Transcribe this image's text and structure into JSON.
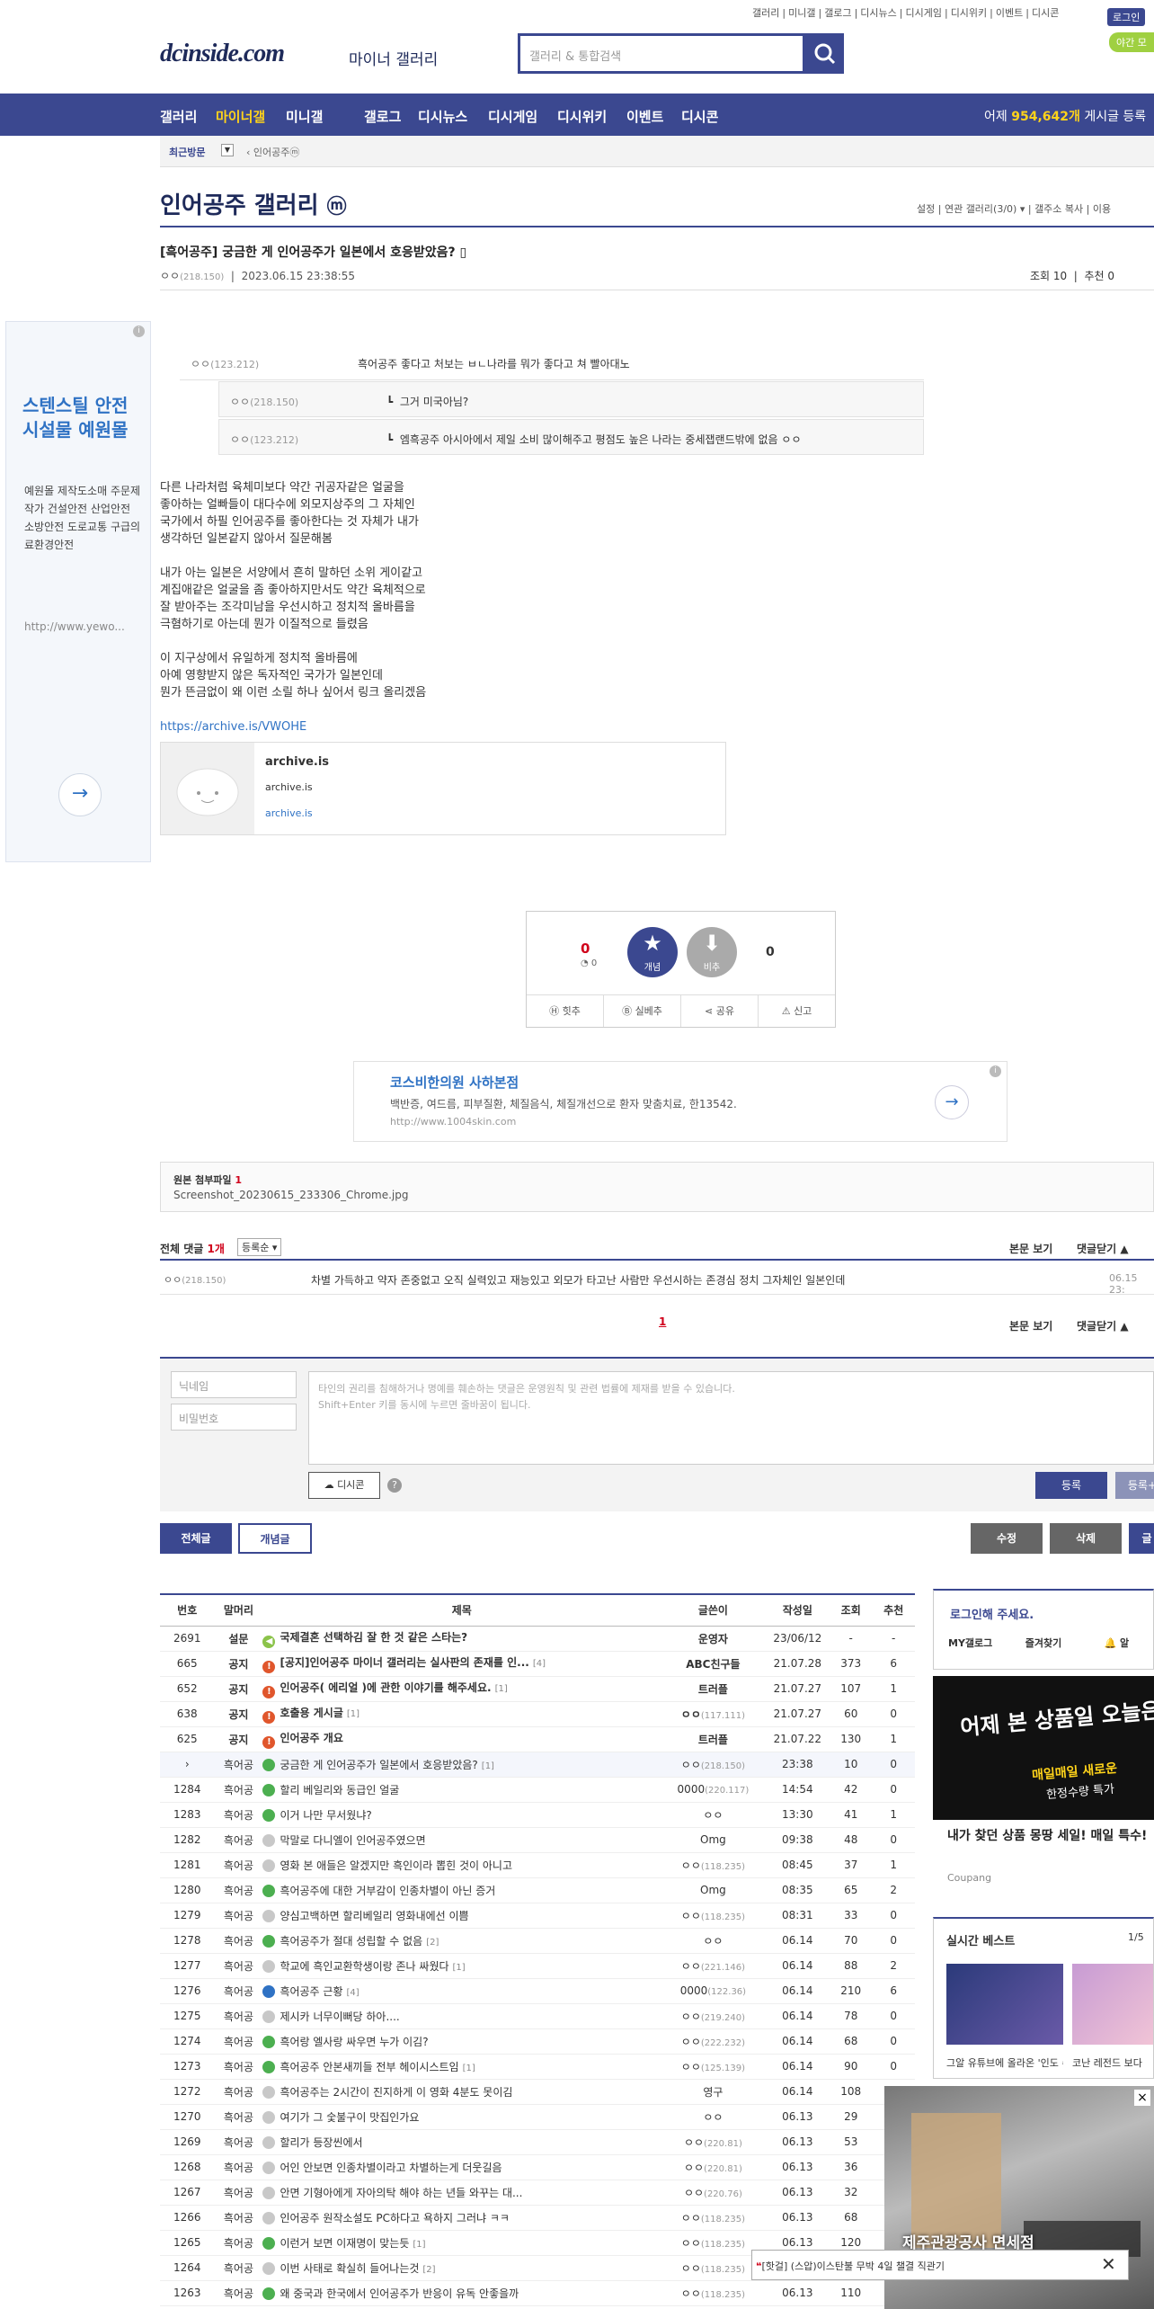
{
  "top_links": [
    "갤러리",
    "미니갤",
    "갤로그",
    "디시뉴스",
    "디시게임",
    "디시위키",
    "이벤트",
    "디시콘"
  ],
  "top_login": "로그인",
  "top_btn2": "야간 모",
  "logo": "dcinside.com",
  "logo_sub": "마이너 갤러리",
  "search": {
    "placeholder": "갤러리 & 통합검색"
  },
  "nav": {
    "items": [
      "갤러리",
      "마이너갤",
      "미니갤",
      "갤로그",
      "디시뉴스",
      "디시게임",
      "디시위키",
      "이벤트",
      "디시콘"
    ],
    "visitors_label": "어제",
    "visitors": "954,642개",
    "visitors_suffix": "게시글 등록"
  },
  "subbar": {
    "recent": "최근방문",
    "gallery": "인어공주ⓜ"
  },
  "gallery_title": "인어공주 갤러리",
  "gallery_badge": "ⓜ",
  "gallery_menu": [
    "설정",
    "연관 갤러리(3/0)",
    "갤주소 복사",
    "이용"
  ],
  "post": {
    "title": "[흑어공주] 궁금한 게 인어공주가 일본에서 호응받았음?",
    "author": "ㅇㅇ",
    "ip": "(218.150)",
    "date": "2023.06.15 23:38:55",
    "views_label": "조회 10",
    "rec_label": "추천 0"
  },
  "ad_left": {
    "title": "스텐스틸 안전시설물 예원몰",
    "desc": "예원몰 제작도소매 주문제작가 건설안전 산업안전 소방안전 도로교통 구급의료환경안전",
    "url": "http://www.yewo..."
  },
  "quoted": [
    {
      "name": "ㅇㅇ",
      "ip": "(123.212)",
      "text": "흑어공주 좋다고 처보는 ㅂㄴ나라를 뭐가 좋다고 쳐 빨아대노"
    },
    {
      "name": "ㅇㅇ",
      "ip": "(218.150)",
      "text": "그거 미국아님?"
    },
    {
      "name": "ㅇㅇ",
      "ip": "(123.212)",
      "text": "엠흑공주 아시아에서 제일 소비 많이해주고 평점도 높은 나라는 중세잽랜드밖에 없음 ㅇㅇ"
    }
  ],
  "body": [
    "다른 나라처럼 육체미보다 약간 귀공자같은 얼굴을",
    "좋아하는 얼빠들이 대다수에 외모지상주의 그 자체인",
    "국가에서 하필 인어공주를 좋아한다는 것 자체가 내가",
    "생각하던 일본같지 않아서 질문해봄",
    "",
    "내가 아는 일본은 서양에서 흔히 말하던 소위 게이같고",
    "계집애같은 얼굴을 좀 좋아하지만서도 약간 육체적으로",
    "잘 받아주는 조각미남을 우선시하고 정치적 올바름을",
    "극혐하기로 아는데 뭔가 이질적으로 들렸음",
    "",
    "이 지구상에서 유일하게 정치적 올바름에",
    "아예 영향받지 않은 독자적인 국가가 일본인데",
    "뭔가 뜬금없이 왜 이런 소릴 하나 싶어서 링크 올리겠음"
  ],
  "link_url": "https://archive.is/VWOHE",
  "card": {
    "title": "archive.is",
    "line2": "archive.is",
    "line3": "archive.is"
  },
  "vote": {
    "up": "0",
    "up_fix": "0",
    "up_label": "개념",
    "down_label": "비추",
    "down": "0",
    "actions": [
      "힛추",
      "실베추",
      "공유",
      "신고"
    ]
  },
  "ad_mid": {
    "title": "코스비한의원 사하본점",
    "desc": "백반증, 여드름, 피부질환, 체질음식, 체질개선으로 환자 맞춤치료, 한13542.",
    "url": "http://www.1004skin.com"
  },
  "attach": {
    "label": "원본 첨부파일",
    "count": "1",
    "file": "Screenshot_20230615_233306_Chrome.jpg"
  },
  "comments": {
    "label": "전체 댓글",
    "count": "1개",
    "sort": "등록순",
    "view": "본문 보기",
    "close": "댓글닫기",
    "items": [
      {
        "name": "ㅇㅇ",
        "ip": "(218.150)",
        "text": "차별 가득하고 약자 존중없고 오직 실력있고 재능있고 외모가 타고난 사람만 우선시하는 존경심 정치 그자체인 일본인데",
        "date": "06.15 23:"
      }
    ],
    "page": "1"
  },
  "write": {
    "nick": "닉네임",
    "pw": "비밀번호",
    "placeholder1": "타인의 권리를 침해하거나 명예를 훼손하는 댓글은 운영원칙 및 관련 법률에 제재를 받을 수 있습니다.",
    "placeholder2": "Shift+Enter 키를 동시에 누르면 줄바꿈이 됩니다.",
    "dccon": "디시콘",
    "submit": "등록",
    "submit2": "등록+"
  },
  "list_btns": {
    "all": "전체글",
    "concept": "개념글",
    "edit": "수정",
    "delete": "삭제",
    "write": "글"
  },
  "list": {
    "headers": [
      "번호",
      "말머리",
      "제목",
      "글쓴이",
      "작성일",
      "조회",
      "추천"
    ],
    "rows": [
      [
        "2691",
        "설문",
        "국제결혼 선택하김 잘 한 것 같은 스타는?",
        "",
        "운영자",
        "",
        "23/06/12",
        "-",
        "-",
        "s"
      ],
      [
        "665",
        "공지",
        "[공지]인어공주 마이너 갤러리는 실사판의 존재를 인...",
        "[4]",
        "ABC친구들",
        "",
        "21.07.28",
        "373",
        "6",
        "n"
      ],
      [
        "652",
        "공지",
        "인어공주( 에리얼 )에 관한 이야기를 해주세요.",
        "[1]",
        "트러플",
        "",
        "21.07.27",
        "107",
        "1",
        "n"
      ],
      [
        "638",
        "공지",
        "호출용 게시글",
        "[1]",
        "ㅇㅇ",
        "(117.111)",
        "21.07.27",
        "60",
        "0",
        "n"
      ],
      [
        "625",
        "공지",
        "인어공주 개요",
        "",
        "트러플",
        "",
        "21.07.22",
        "130",
        "1",
        "n"
      ],
      [
        "›",
        "흑어공",
        "궁금한 게 인어공주가 일본에서 호응받았음?",
        "[1]",
        "ㅇㅇ",
        "(218.150)",
        "23:38",
        "10",
        "0",
        "c"
      ],
      [
        "1284",
        "흑어공",
        "할리 베일리와 동급인 얼굴",
        "",
        "0000",
        "(220.117)",
        "14:54",
        "42",
        "0",
        "g"
      ],
      [
        "1283",
        "흑어공",
        "이거 나만 무서웠냐?",
        "",
        "ㅇㅇ",
        "",
        "13:30",
        "41",
        "1",
        "g"
      ],
      [
        "1282",
        "흑어공",
        "막말로 다니엘이 인어공주였으면",
        "",
        "Omg",
        "",
        "09:38",
        "48",
        "0",
        "t"
      ],
      [
        "1281",
        "흑어공",
        "영화 본 애들은 알겠지만 흑인이라 뽑힌 것이 아니고",
        "",
        "ㅇㅇ",
        "(118.235)",
        "08:45",
        "37",
        "1",
        "t"
      ],
      [
        "1280",
        "흑어공",
        "흑어공주에 대한 거부감이 인종차별이 아닌 증거",
        "",
        "Omg",
        "",
        "08:35",
        "65",
        "2",
        "g"
      ],
      [
        "1279",
        "흑어공",
        "양심고백하면 할리베일리 영화내에선 이쁨",
        "",
        "ㅇㅇ",
        "(118.235)",
        "08:31",
        "33",
        "0",
        "t"
      ],
      [
        "1278",
        "흑어공",
        "흑어공주가 절대 성립할 수 없음",
        "[2]",
        "ㅇㅇ",
        "",
        "06.14",
        "70",
        "0",
        "g"
      ],
      [
        "1277",
        "흑어공",
        "학교에 흑인교환학생이랑 존나 싸웠다",
        "[1]",
        "ㅇㅇ",
        "(221.146)",
        "06.14",
        "88",
        "2",
        "t"
      ],
      [
        "1276",
        "흑어공",
        "흑어공주 근황",
        "[4]",
        "0000",
        "(122.36)",
        "06.14",
        "210",
        "6",
        "b"
      ],
      [
        "1275",
        "흑어공",
        "제시카 너무이뻐당 하아....",
        "",
        "ㅇㅇ",
        "(219.240)",
        "06.14",
        "78",
        "0",
        "t"
      ],
      [
        "1274",
        "흑어공",
        "흑어랑 엘사랑 싸우면 누가 이김?",
        "",
        "ㅇㅇ",
        "(222.232)",
        "06.14",
        "68",
        "0",
        "g"
      ],
      [
        "1273",
        "흑어공",
        "흑어공주 안본새끼들 전부 헤이시스트임",
        "[1]",
        "ㅇㅇ",
        "(125.139)",
        "06.14",
        "90",
        "0",
        "g"
      ],
      [
        "1272",
        "흑어공",
        "흑어공주는 2시간이 진지하게 이 영화 4분도 못이김",
        "",
        "영구",
        "",
        "06.14",
        "108",
        "0",
        "t"
      ],
      [
        "1270",
        "흑어공",
        "여기가 그 숯불구이 맛집인가요",
        "",
        "ㅇㅇ",
        "",
        "06.13",
        "29",
        "0",
        "t"
      ],
      [
        "1269",
        "흑어공",
        "할리가 등장씬에서",
        "",
        "ㅇㅇ",
        "(220.81)",
        "06.13",
        "53",
        "0",
        "t"
      ],
      [
        "1268",
        "흑어공",
        "어인 안보면 인종차별이라고 차별하는게 더웃길음",
        "",
        "ㅇㅇ",
        "(220.81)",
        "06.13",
        "36",
        "0",
        "t"
      ],
      [
        "1267",
        "흑어공",
        "안면 기형아에게 자아의탁 해야 하는 년들 와꾸는 대...",
        "",
        "ㅇㅇ",
        "(220.76)",
        "06.13",
        "32",
        "0",
        "t"
      ],
      [
        "1266",
        "흑어공",
        "인어공주 원작소설도 PC하다고 욕하지 그러냐 ㅋㅋ",
        "",
        "ㅇㅇ",
        "(118.235)",
        "06.13",
        "68",
        "0",
        "t"
      ],
      [
        "1265",
        "흑어공",
        "이런거 보면 이재명이 맞는듯",
        "[1]",
        "ㅇㅇ",
        "(118.235)",
        "06.13",
        "120",
        "0",
        "g"
      ],
      [
        "1264",
        "흑어공",
        "이번 사태로 확실히 들어나는것",
        "[2]",
        "ㅇㅇ",
        "(118.235)",
        "06.13",
        "120",
        "0",
        "t"
      ],
      [
        "1263",
        "흑어공",
        "왜 중국과 한국에서 인어공주가 반응이 유독 안좋을까",
        "",
        "ㅇㅇ",
        "(118.235)",
        "06.13",
        "110",
        "0",
        "g"
      ]
    ]
  },
  "right": {
    "login_msg": "로그인해 주세요.",
    "btns": [
      "MY갤로그",
      "즐겨찾기",
      "알"
    ],
    "ad_banner": "어제 본 상품일 오늘은 없다?",
    "ad_sub": "매일매일 새로운",
    "ad_sub2": "한정수량 특가",
    "ad_title": "내가 찾던 상품 몽땅 세일! 매일 특수!",
    "ad_src": "Coupang",
    "best": "실시간 베스트",
    "best_page": "1/5",
    "best_items": [
      "그알 유튜브에 올라온 '인도 수'",
      "코난 레전드 보다"
    ]
  },
  "float_ad": {
    "title": "제주관광공사 면세점",
    "news": "[핫걸] (스압)이스탄불 무박 4일 챌결 직관기"
  },
  "colors": {
    "brand": "#3b4890",
    "accent": "#ffd31a",
    "red": "#d0021b"
  }
}
